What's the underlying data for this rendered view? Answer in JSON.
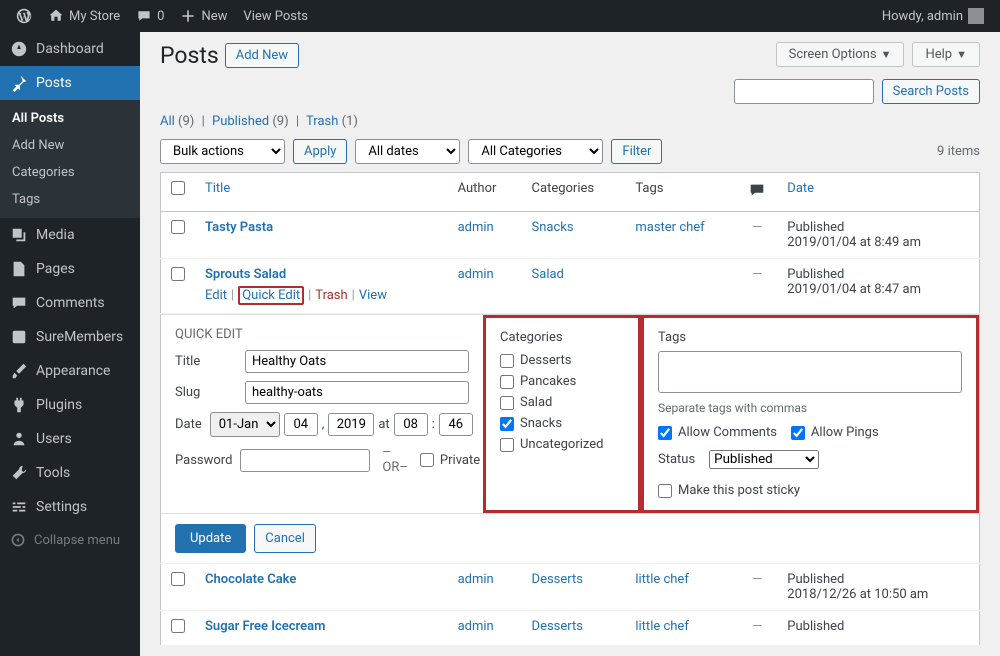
{
  "topbar": {
    "site_name": "My Store",
    "comments_count": "0",
    "new_label": "New",
    "view_posts": "View Posts",
    "howdy": "Howdy, admin"
  },
  "sidebar": {
    "dashboard": "Dashboard",
    "posts": "Posts",
    "all_posts": "All Posts",
    "add_new": "Add New",
    "categories": "Categories",
    "tags": "Tags",
    "media": "Media",
    "pages": "Pages",
    "comments": "Comments",
    "suremembers": "SureMembers",
    "appearance": "Appearance",
    "plugins": "Plugins",
    "users": "Users",
    "tools": "Tools",
    "settings": "Settings",
    "collapse": "Collapse menu"
  },
  "header": {
    "title": "Posts",
    "add_new": "Add New",
    "screen_options": "Screen Options",
    "help": "Help",
    "search_btn": "Search Posts"
  },
  "subsub": {
    "all": "All",
    "all_count": "(9)",
    "published": "Published",
    "published_count": "(9)",
    "trash": "Trash",
    "trash_count": "(1)"
  },
  "filters": {
    "bulk": "Bulk actions",
    "apply": "Apply",
    "dates": "All dates",
    "cats": "All Categories",
    "filter": "Filter",
    "count": "9 items"
  },
  "columns": {
    "title": "Title",
    "author": "Author",
    "categories": "Categories",
    "tags": "Tags",
    "date": "Date"
  },
  "rows": [
    {
      "title": "Tasty Pasta",
      "author": "admin",
      "categories": "Snacks",
      "tags": "master chef",
      "comments": "—",
      "date_status": "Published",
      "date_stamp": "2019/01/04 at 8:49 am"
    },
    {
      "title": "Sprouts Salad",
      "author": "admin",
      "categories": "Salad",
      "tags": "",
      "comments": "—",
      "date_status": "Published",
      "date_stamp": "2019/01/04 at 8:47 am"
    },
    {
      "title": "Chocolate Cake",
      "author": "admin",
      "categories": "Desserts",
      "tags": "little chef",
      "comments": "—",
      "date_status": "Published",
      "date_stamp": "2018/12/26 at 10:50 am"
    },
    {
      "title": "Sugar Free Icecream",
      "author": "admin",
      "categories": "Desserts",
      "tags": "little chef",
      "comments": "—",
      "date_status": "Published",
      "date_stamp": ""
    }
  ],
  "row_actions": {
    "edit": "Edit",
    "quick_edit": "Quick Edit",
    "trash": "Trash",
    "view": "View"
  },
  "quick_edit": {
    "heading": "QUICK EDIT",
    "title_label": "Title",
    "title_value": "Healthy Oats",
    "slug_label": "Slug",
    "slug_value": "healthy-oats",
    "date_label": "Date",
    "month": "01-Jan",
    "day": "04",
    "year": "2019",
    "at": "at",
    "hour": "08",
    "minute": "46",
    "password_label": "Password",
    "or": "–OR–",
    "private": "Private",
    "categories_label": "Categories",
    "cat_list": [
      "Desserts",
      "Pancakes",
      "Salad",
      "Snacks",
      "Uncategorized"
    ],
    "cat_checked": "Snacks",
    "tags_label": "Tags",
    "tags_help": "Separate tags with commas",
    "allow_comments": "Allow Comments",
    "allow_pings": "Allow Pings",
    "status_label": "Status",
    "status_value": "Published",
    "sticky": "Make this post sticky",
    "update": "Update",
    "cancel": "Cancel"
  }
}
